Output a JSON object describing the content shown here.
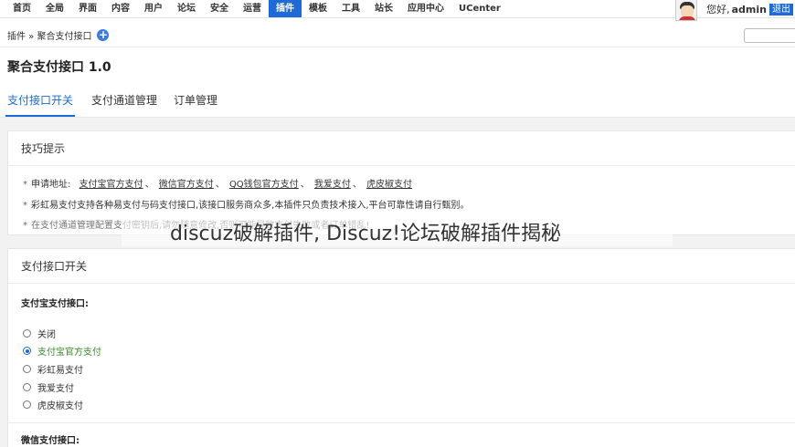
{
  "nav": {
    "items": [
      "首页",
      "全局",
      "界面",
      "内容",
      "用户",
      "论坛",
      "安全",
      "运营",
      "插件",
      "模板",
      "工具",
      "站长",
      "应用中心",
      "UCenter"
    ],
    "active_index": 8
  },
  "user": {
    "greeting": "您好,",
    "name": "admin",
    "logout": "退出"
  },
  "breadcrumb": {
    "text": "插件 » 聚合支付接口",
    "add_icon": "plus-circle-icon"
  },
  "page": {
    "title": "聚合支付接口 1.0"
  },
  "tabs": [
    "支付接口开关",
    "支付通道管理",
    "订单管理"
  ],
  "tips": {
    "heading": "技巧提示",
    "apply_label": "申请地址:",
    "apply_links": [
      "支付宝官方支付",
      "微信官方支付",
      "QQ钱包官方支付",
      "我爱支付",
      "虎皮椒支付"
    ],
    "sep": "、",
    "line2": "彩虹易支付支持各种易支付与码支付接口,该接口服务商众多,本插件只负责技术接入,平台可靠性请自行甄别。",
    "line3": "在支付通道管理配置支付密钥后,请勿随意修改,否则可能导致支付失败或者订单错乱!"
  },
  "switch": {
    "heading": "支付接口开关",
    "alipay_label": "支付宝支付接口:",
    "options": [
      "关闭",
      "支付宝官方支付",
      "彩虹易支付",
      "我爱支付",
      "虎皮椒支付"
    ],
    "selected_index": 1,
    "wechat_label": "微信支付接口:"
  },
  "watermark": "discuz破解插件, Discuz!论坛破解插件揭秘",
  "colors": {
    "accent": "#1c6bd8",
    "selected_text": "#3a8a2a"
  }
}
